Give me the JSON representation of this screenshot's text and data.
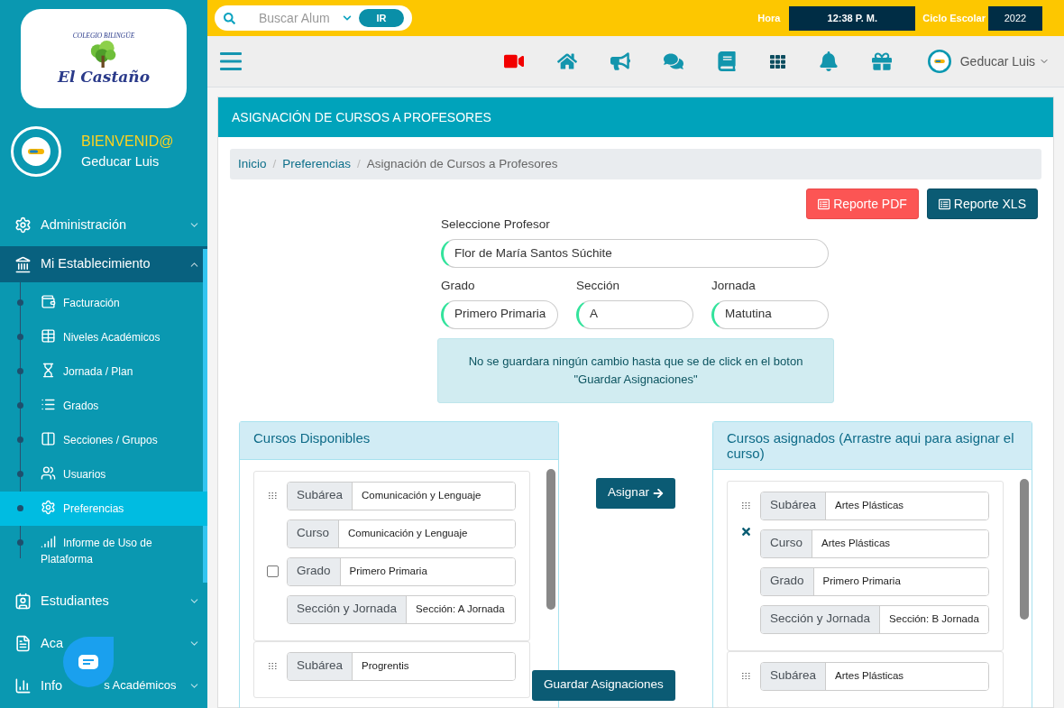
{
  "sidebar": {
    "logo": {
      "arc": "COLEGIO BILINGÜE",
      "name": "El Castaño"
    },
    "welcome": "BIENVENID@",
    "user": "Geducar Luis",
    "menu": [
      {
        "label": "Administración",
        "expanded": false,
        "selected": false
      },
      {
        "label": "Mi Establecimiento",
        "expanded": true,
        "selected": true,
        "children": [
          {
            "label": "Facturación",
            "selected": false
          },
          {
            "label": "Niveles Académicos",
            "selected": false
          },
          {
            "label": "Jornada / Plan",
            "selected": false
          },
          {
            "label": "Grados",
            "selected": false
          },
          {
            "label": "Secciones / Grupos",
            "selected": false
          },
          {
            "label": "Usuarios",
            "selected": false
          },
          {
            "label": "Preferencias",
            "selected": true
          },
          {
            "label": "Informe de Uso de Plataforma",
            "selected": false
          }
        ]
      },
      {
        "label": "Estudiantes",
        "expanded": false,
        "selected": false
      },
      {
        "label": "Aca",
        "expanded": false,
        "selected": false
      },
      {
        "label": "Info",
        "label_tail": "s Académicos",
        "expanded": false,
        "selected": false
      }
    ]
  },
  "topbar": {
    "search_placeholder": "Buscar Alum",
    "go_button": "IR",
    "time_label": "Hora",
    "time": "12:38 P. M.",
    "cycle_label": "Ciclo Escolar",
    "cycle": "2022"
  },
  "navbar": {
    "user": "Geducar Luis"
  },
  "card": {
    "title": "ASIGNACIÓN DE CURSOS A PROFESORES",
    "breadcrumb": {
      "separator": "/",
      "items": [
        {
          "label": "Inicio",
          "link": true
        },
        {
          "label": "Preferencias",
          "link": true
        },
        {
          "label": "Asignación de Cursos a Profesores",
          "link": false
        }
      ]
    },
    "buttons": [
      {
        "label": "Reporte PDF",
        "kind": "pdf"
      },
      {
        "label": "Reporte XLS",
        "kind": "xls"
      }
    ],
    "teacher": {
      "label": "Seleccione Profesor",
      "value": "Flor de María Santos Súchite"
    },
    "filters": [
      {
        "label": "Grado",
        "value": "Primero Primaria"
      },
      {
        "label": "Sección",
        "value": "A"
      },
      {
        "label": "Jornada",
        "value": "Matutina"
      }
    ],
    "notice": "No se guardara ningún cambio hasta que se de click en el boton \"Guardar Asignaciones\"",
    "assign_button": "Asignar",
    "save_button": "Guardar Asignaciones",
    "panels": [
      {
        "kind": "available",
        "title": "Cursos Disponibles",
        "items": [
          {
            "checked": false,
            "fields": [
              {
                "label": "Subárea",
                "value": "Comunicación y Lenguaje"
              },
              {
                "label": "Curso",
                "value": "Comunicación y Lenguaje"
              },
              {
                "label": "Grado",
                "value": "Primero Primaria"
              },
              {
                "label": "Sección y Jornada",
                "value": "Sección: A Jornada"
              }
            ]
          },
          {
            "fields": [
              {
                "label": "Subárea",
                "value": "Progrentis"
              }
            ]
          }
        ]
      },
      {
        "kind": "assigned",
        "title": "Cursos asignados (Arrastre aqui para asignar el curso)",
        "items": [
          {
            "fields": [
              {
                "label": "Subárea",
                "value": "Artes Plásticas"
              },
              {
                "label": "Curso",
                "value": "Artes Plásticas"
              },
              {
                "label": "Grado",
                "value": "Primero Primaria"
              },
              {
                "label": "Sección y Jornada",
                "value": "Sección: B Jornada"
              }
            ]
          },
          {
            "fields": [
              {
                "label": "Subárea",
                "value": "Artes Plásticas"
              }
            ]
          }
        ]
      }
    ]
  }
}
